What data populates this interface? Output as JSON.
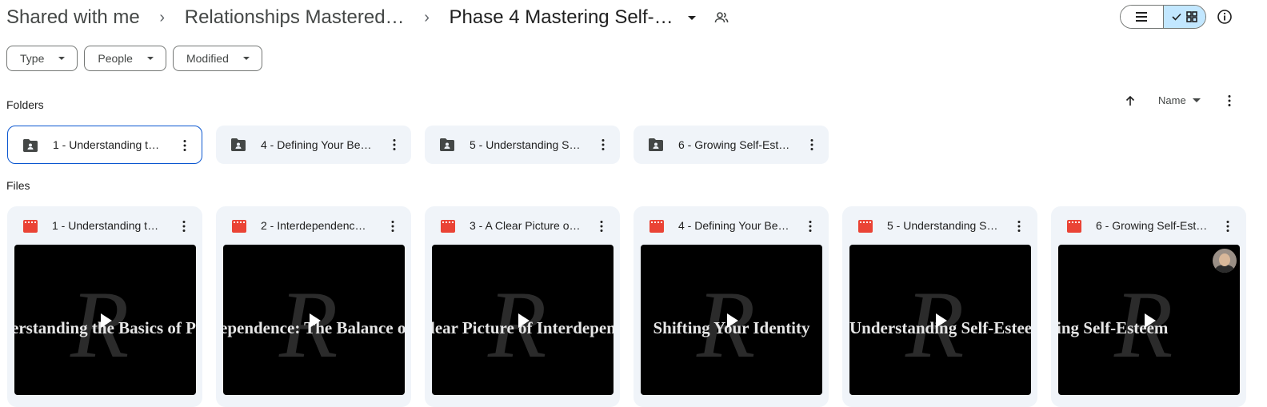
{
  "breadcrumb": {
    "items": [
      "Shared with me",
      "Relationships Mastered…",
      "Phase 4 Mastering Self-…"
    ],
    "separator": "›"
  },
  "filters": [
    {
      "label": "Type"
    },
    {
      "label": "People"
    },
    {
      "label": "Modified"
    }
  ],
  "sections": {
    "folders": "Folders",
    "files": "Files"
  },
  "sort": {
    "label": "Name",
    "direction_icon": "arrow-up-icon"
  },
  "folders": [
    {
      "name": "1 - Understanding t…",
      "icon": "shared-folder-icon",
      "selected": true
    },
    {
      "name": "4 - Defining Your Be…",
      "icon": "shared-folder-icon",
      "selected": false
    },
    {
      "name": "5 - Understanding S…",
      "icon": "shared-folder-icon",
      "selected": false
    },
    {
      "name": "6 - Growing Self-Est…",
      "icon": "shared-folder-icon",
      "selected": false
    }
  ],
  "files": [
    {
      "name": "1 - Understanding t…",
      "icon": "video-icon",
      "thumb_text": "erstanding the Basics of P"
    },
    {
      "name": "2 - Interdependenc…",
      "icon": "video-icon",
      "thumb_text": "ependence: The Balance of"
    },
    {
      "name": "3 - A Clear Picture o…",
      "icon": "video-icon",
      "thumb_text": "lear Picture of Interdepend"
    },
    {
      "name": "4 - Defining Your Be…",
      "icon": "video-icon",
      "thumb_text": "Shifting Your Identity"
    },
    {
      "name": "5 - Understanding S…",
      "icon": "video-icon",
      "thumb_text": "Understanding Self-Esteem"
    },
    {
      "name": "6 - Growing Self-Est…",
      "icon": "video-icon",
      "thumb_text": "ing Self-Esteem"
    }
  ],
  "colors": {
    "accent": "#0b57d0",
    "toggle_active": "#c2e7ff",
    "card_bg": "#f0f4f9",
    "video_icon": "#ea4335"
  }
}
